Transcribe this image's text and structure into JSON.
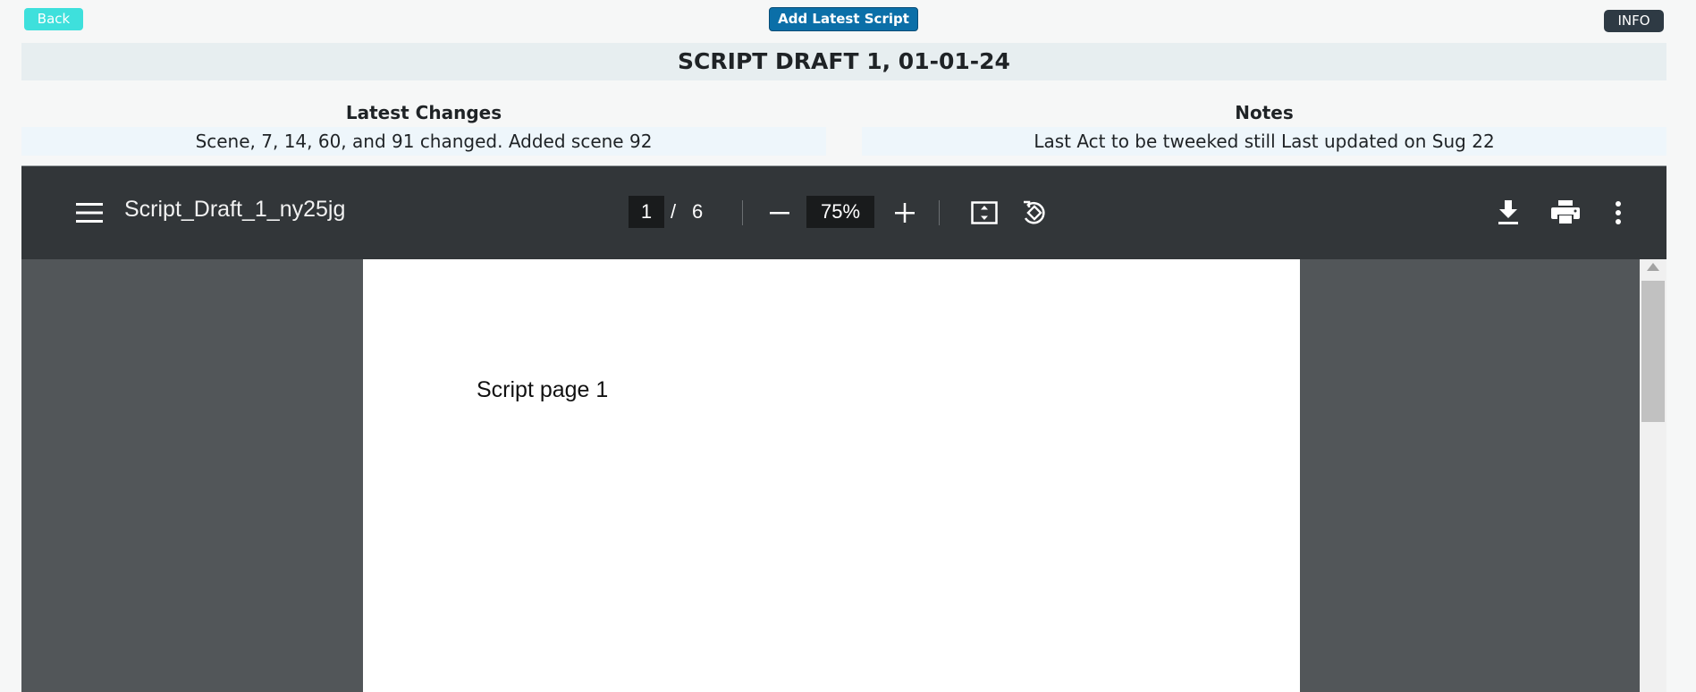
{
  "topbar": {
    "back_label": "Back",
    "add_label": "Add Latest Script",
    "info_label": "INFO"
  },
  "header": {
    "title": "SCRIPT DRAFT 1, 01-01-24"
  },
  "latest_changes": {
    "heading": "Latest Changes",
    "text": "Scene, 7, 14, 60, and 91 changed. Added scene 92"
  },
  "notes": {
    "heading": "Notes",
    "text": "Last Act to be tweeked still Last updated on Sug 22"
  },
  "viewer": {
    "file_name": "Script_Draft_1_ny25jg",
    "current_page": "1",
    "page_separator": "/",
    "total_pages": "6",
    "zoom": "75%",
    "page_text": "Script page 1",
    "icons": [
      "menu-icon",
      "zoom-out-icon",
      "zoom-in-icon",
      "fit-page-icon",
      "rotate-icon",
      "download-icon",
      "print-icon",
      "more-icon"
    ]
  },
  "colors": {
    "back_button": "#3ee0dc",
    "add_button": "#0b6fa8",
    "info_button": "#2e3a44",
    "toolbar": "#323639",
    "viewer_bg": "#525659"
  }
}
